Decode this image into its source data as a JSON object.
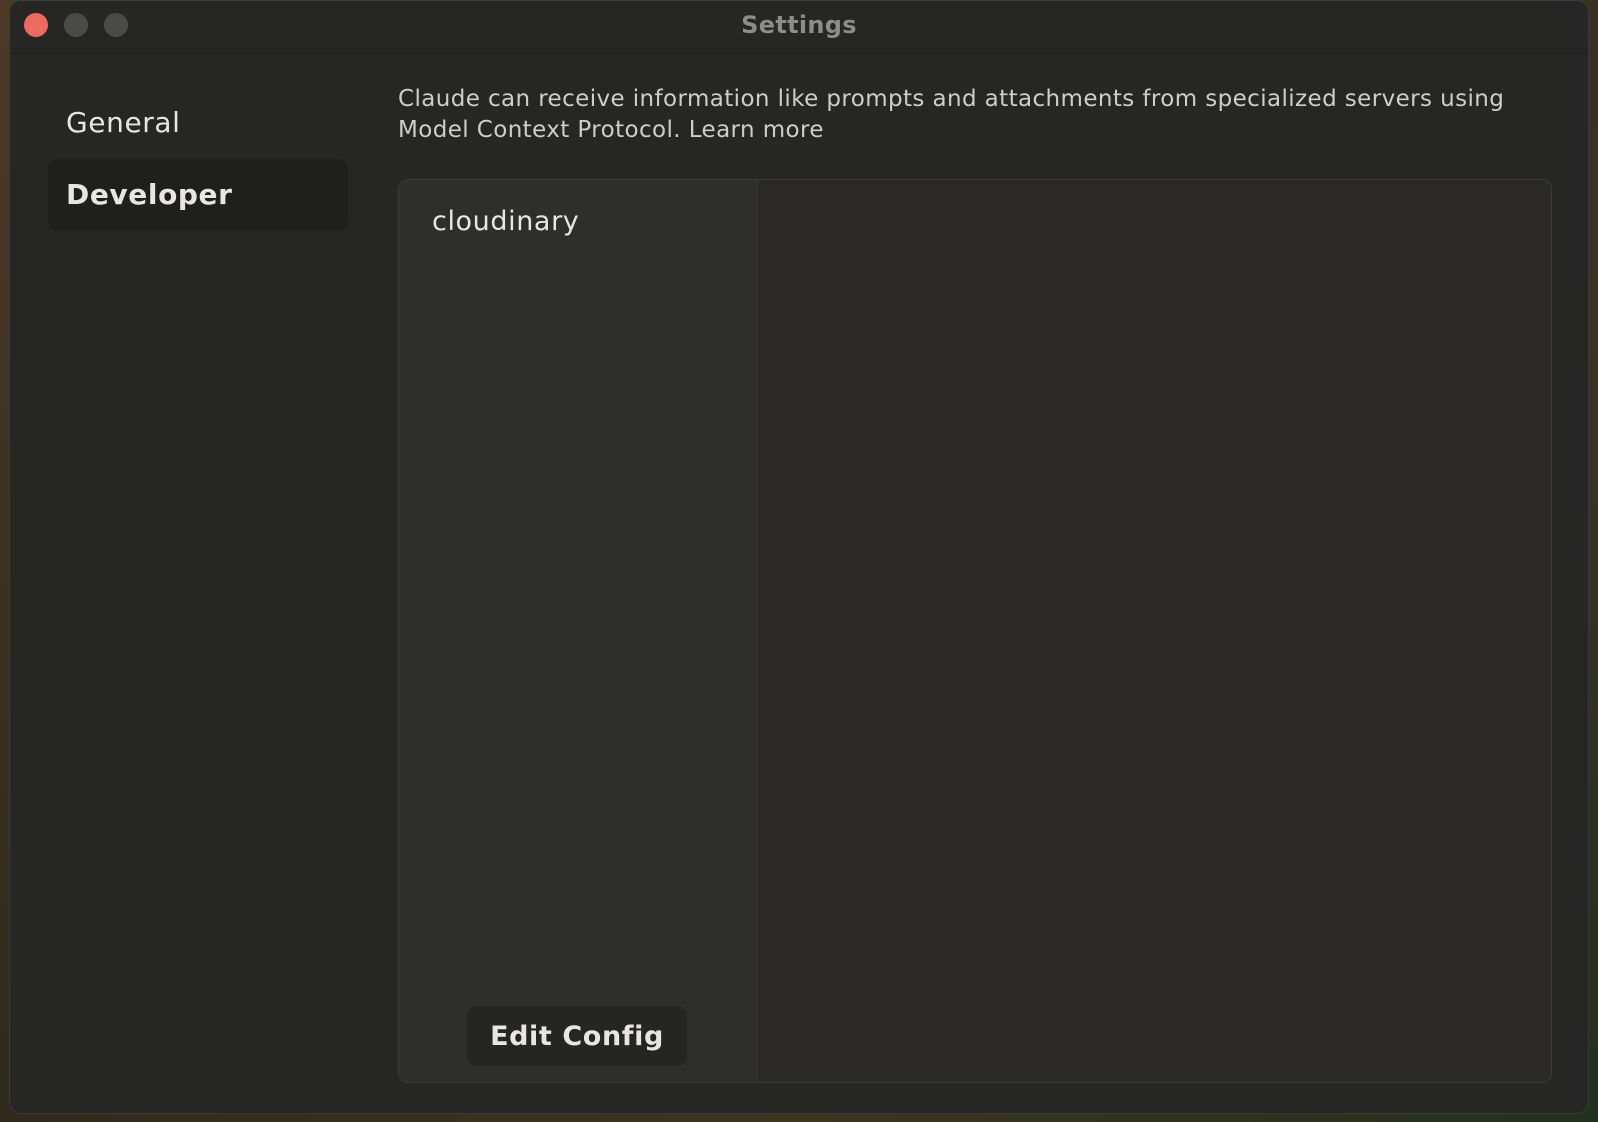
{
  "window": {
    "title": "Settings"
  },
  "sidebar": {
    "items": [
      {
        "label": "General",
        "active": false
      },
      {
        "label": "Developer",
        "active": true
      }
    ]
  },
  "main": {
    "description": "Claude can receive information like prompts and attachments from specialized servers using Model Context Protocol.",
    "learn_more": "Learn more",
    "servers": [
      {
        "name": "cloudinary"
      }
    ],
    "edit_config_label": "Edit Config"
  },
  "colors": {
    "window_bg": "#262624",
    "close_button": "#ec6a5f",
    "text_primary": "#e8e6e1",
    "active_nav_bg": "#1f1f1d"
  }
}
